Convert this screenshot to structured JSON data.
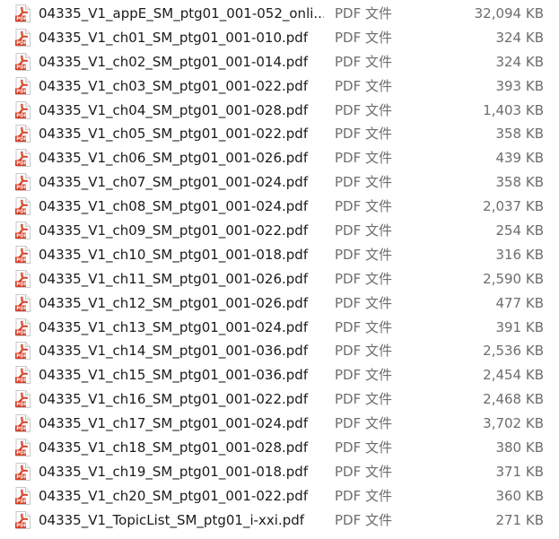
{
  "icon": "pdf-file-icon",
  "colors": {
    "icon_red": "#d83b22",
    "name_text": "#1a1a1a",
    "meta_text": "#6d6d6d"
  },
  "files": [
    {
      "name": "04335_V1_appE_SM_ptg01_001-052_onli...",
      "type": "PDF 文件",
      "size": "32,094 KB"
    },
    {
      "name": "04335_V1_ch01_SM_ptg01_001-010.pdf",
      "type": "PDF 文件",
      "size": "324 KB"
    },
    {
      "name": "04335_V1_ch02_SM_ptg01_001-014.pdf",
      "type": "PDF 文件",
      "size": "324 KB"
    },
    {
      "name": "04335_V1_ch03_SM_ptg01_001-022.pdf",
      "type": "PDF 文件",
      "size": "393 KB"
    },
    {
      "name": "04335_V1_ch04_SM_ptg01_001-028.pdf",
      "type": "PDF 文件",
      "size": "1,403 KB"
    },
    {
      "name": "04335_V1_ch05_SM_ptg01_001-022.pdf",
      "type": "PDF 文件",
      "size": "358 KB"
    },
    {
      "name": "04335_V1_ch06_SM_ptg01_001-026.pdf",
      "type": "PDF 文件",
      "size": "439 KB"
    },
    {
      "name": "04335_V1_ch07_SM_ptg01_001-024.pdf",
      "type": "PDF 文件",
      "size": "358 KB"
    },
    {
      "name": "04335_V1_ch08_SM_ptg01_001-024.pdf",
      "type": "PDF 文件",
      "size": "2,037 KB"
    },
    {
      "name": "04335_V1_ch09_SM_ptg01_001-022.pdf",
      "type": "PDF 文件",
      "size": "254 KB"
    },
    {
      "name": "04335_V1_ch10_SM_ptg01_001-018.pdf",
      "type": "PDF 文件",
      "size": "316 KB"
    },
    {
      "name": "04335_V1_ch11_SM_ptg01_001-026.pdf",
      "type": "PDF 文件",
      "size": "2,590 KB"
    },
    {
      "name": "04335_V1_ch12_SM_ptg01_001-026.pdf",
      "type": "PDF 文件",
      "size": "477 KB"
    },
    {
      "name": "04335_V1_ch13_SM_ptg01_001-024.pdf",
      "type": "PDF 文件",
      "size": "391 KB"
    },
    {
      "name": "04335_V1_ch14_SM_ptg01_001-036.pdf",
      "type": "PDF 文件",
      "size": "2,536 KB"
    },
    {
      "name": "04335_V1_ch15_SM_ptg01_001-036.pdf",
      "type": "PDF 文件",
      "size": "2,454 KB"
    },
    {
      "name": "04335_V1_ch16_SM_ptg01_001-022.pdf",
      "type": "PDF 文件",
      "size": "2,468 KB"
    },
    {
      "name": "04335_V1_ch17_SM_ptg01_001-024.pdf",
      "type": "PDF 文件",
      "size": "3,702 KB"
    },
    {
      "name": "04335_V1_ch18_SM_ptg01_001-028.pdf",
      "type": "PDF 文件",
      "size": "380 KB"
    },
    {
      "name": "04335_V1_ch19_SM_ptg01_001-018.pdf",
      "type": "PDF 文件",
      "size": "371 KB"
    },
    {
      "name": "04335_V1_ch20_SM_ptg01_001-022.pdf",
      "type": "PDF 文件",
      "size": "360 KB"
    },
    {
      "name": "04335_V1_TopicList_SM_ptg01_i-xxi.pdf",
      "type": "PDF 文件",
      "size": "271 KB"
    }
  ]
}
